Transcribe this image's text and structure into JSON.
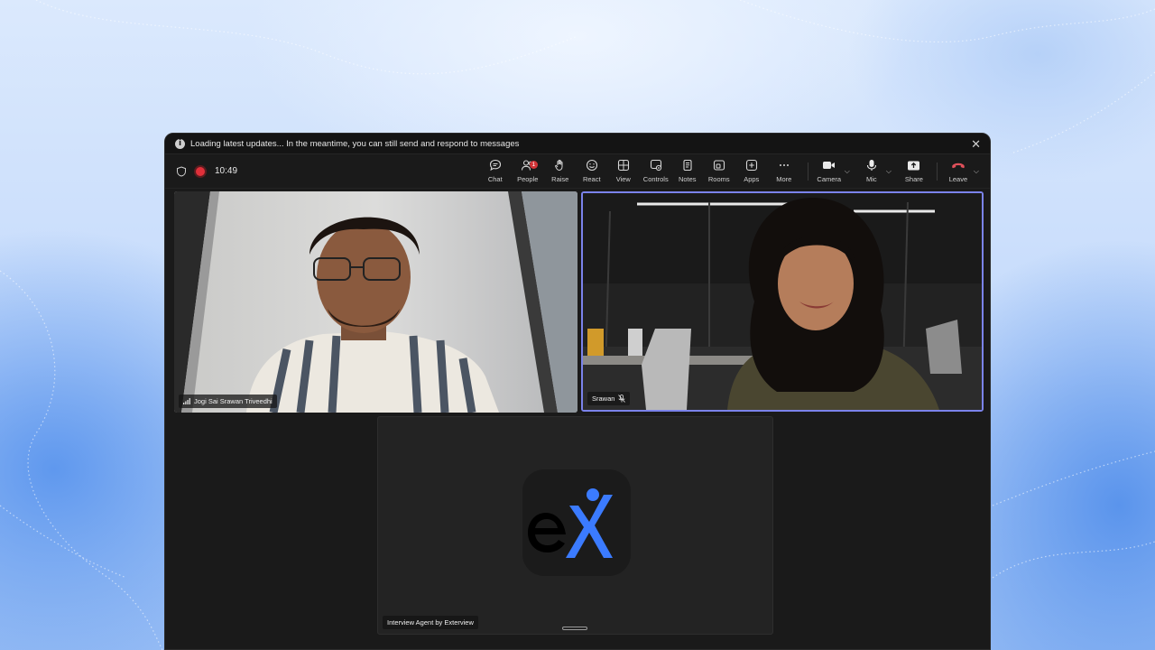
{
  "banner": {
    "message": "Loading latest updates... In the meantime, you can still send and respond to messages",
    "close_icon": "close-icon"
  },
  "toolbar": {
    "time": "10:49",
    "tools": [
      {
        "id": "chat",
        "label": "Chat",
        "icon": "chat-icon"
      },
      {
        "id": "people",
        "label": "People",
        "icon": "people-icon",
        "badge": "1"
      },
      {
        "id": "raise",
        "label": "Raise",
        "icon": "hand-icon"
      },
      {
        "id": "react",
        "label": "React",
        "icon": "smile-icon"
      },
      {
        "id": "view",
        "label": "View",
        "icon": "grid-icon"
      },
      {
        "id": "controls",
        "label": "Controls",
        "icon": "controls-icon"
      },
      {
        "id": "notes",
        "label": "Notes",
        "icon": "notes-icon"
      },
      {
        "id": "rooms",
        "label": "Rooms",
        "icon": "rooms-icon"
      },
      {
        "id": "apps",
        "label": "Apps",
        "icon": "apps-icon"
      },
      {
        "id": "more",
        "label": "More",
        "icon": "more-icon"
      }
    ],
    "camera_label": "Camera",
    "mic_label": "Mic",
    "share_label": "Share",
    "leave_label": "Leave"
  },
  "participants": [
    {
      "name": "Jogi Sai Srawan Triveedhi"
    },
    {
      "name": "Srawan"
    },
    {
      "name": "Interview Agent by Exterview"
    }
  ],
  "colors": {
    "accent": "#7b83eb",
    "record": "#e0303a",
    "leave": "#e0505a",
    "logo_blue": "#3b7bff"
  }
}
